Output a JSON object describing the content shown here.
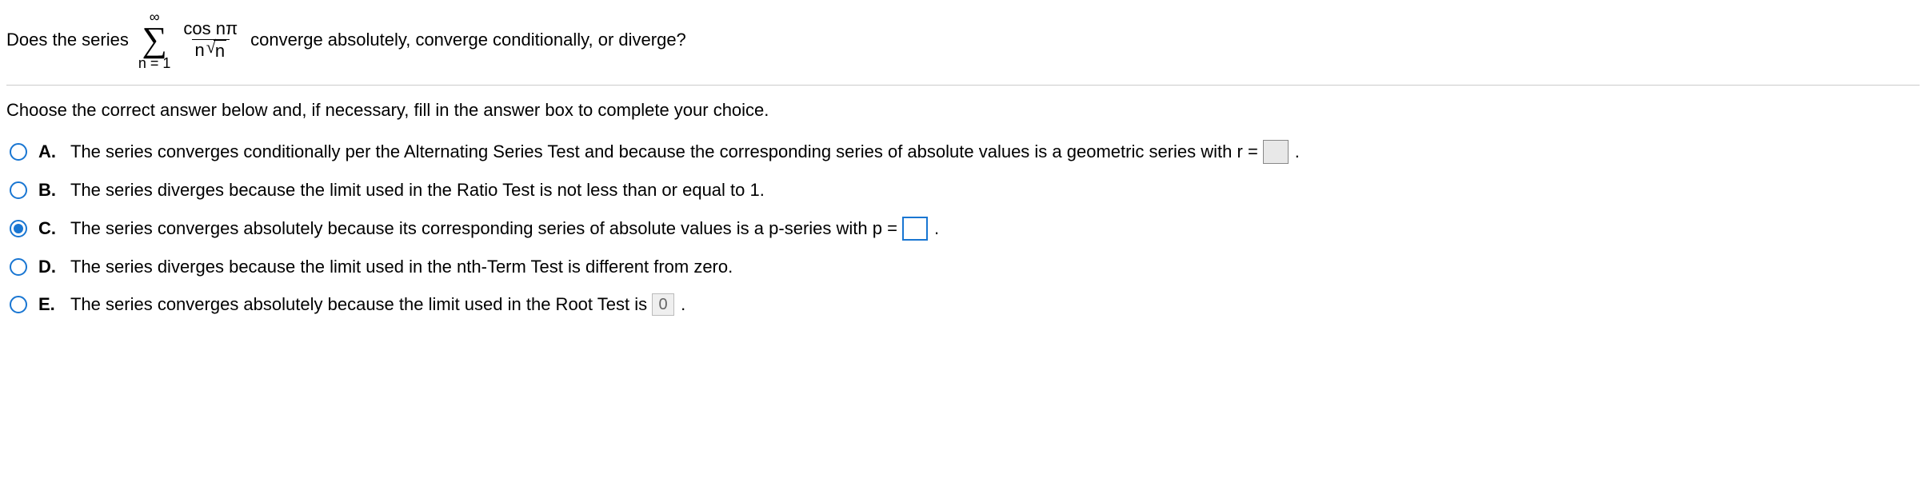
{
  "question": {
    "prefix": "Does the series",
    "sigma_top": "∞",
    "sigma_bottom": "n = 1",
    "frac_num": "cos nπ",
    "frac_den_left": "n",
    "frac_den_sqrt": "n",
    "suffix": "converge absolutely, converge conditionally, or diverge?"
  },
  "instruction": "Choose the correct answer below and, if necessary, fill in the answer box to complete your choice.",
  "choices": {
    "a": {
      "label": "A.",
      "text_before": "The series converges conditionally per the Alternating Series Test and because the corresponding series of absolute values is a geometric series with r =",
      "box_value": "",
      "period": "."
    },
    "b": {
      "label": "B.",
      "text": "The series diverges because the limit used in the Ratio Test is not less than or equal to 1."
    },
    "c": {
      "label": "C.",
      "text_before": "The series converges absolutely because its corresponding series of absolute values is a p-series with p =",
      "box_value": "",
      "period": "."
    },
    "d": {
      "label": "D.",
      "text": "The series diverges because the limit used in the nth-Term Test is different from zero."
    },
    "e": {
      "label": "E.",
      "text_before": "The series converges absolutely because the limit used in the Root Test is",
      "box_value": "0",
      "period": "."
    }
  },
  "selected": "c"
}
